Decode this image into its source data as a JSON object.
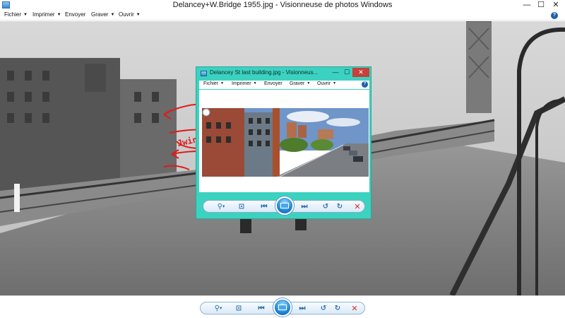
{
  "window": {
    "title": "Delancey+W.Bridge 1955.jpg - Visionneuse de photos Windows",
    "minimize_glyph": "—",
    "maximize_glyph": "☐",
    "close_glyph": "✕"
  },
  "menu": {
    "items": [
      {
        "label": "Fichier"
      },
      {
        "label": "Imprimer"
      },
      {
        "label": "Envoyer"
      },
      {
        "label": "Graver"
      },
      {
        "label": "Ouvrir"
      }
    ],
    "dropdown_glyph": "▼",
    "help_glyph": "?"
  },
  "controls": {
    "zoom_glyph": "⚲",
    "zoom_arrow": "▾",
    "fit_glyph": "⊡",
    "prev_glyph": "⏮",
    "next_glyph": "⏭",
    "rotate_left_glyph": "↺",
    "rotate_right_glyph": "↻",
    "delete_glyph": "✕"
  },
  "inner_window": {
    "title": "Delancey St last building.jpg - Visionneus...",
    "minimize_glyph": "—",
    "maximize_glyph": "☐",
    "close_glyph": "✕"
  },
  "annotation": {
    "text": "Jwindows"
  },
  "colors": {
    "inner_window_frame": "#3cd2c0",
    "annotation_red": "#e01b1b",
    "control_blue": "#2d6fb4",
    "delete_red": "#d62b2b"
  }
}
